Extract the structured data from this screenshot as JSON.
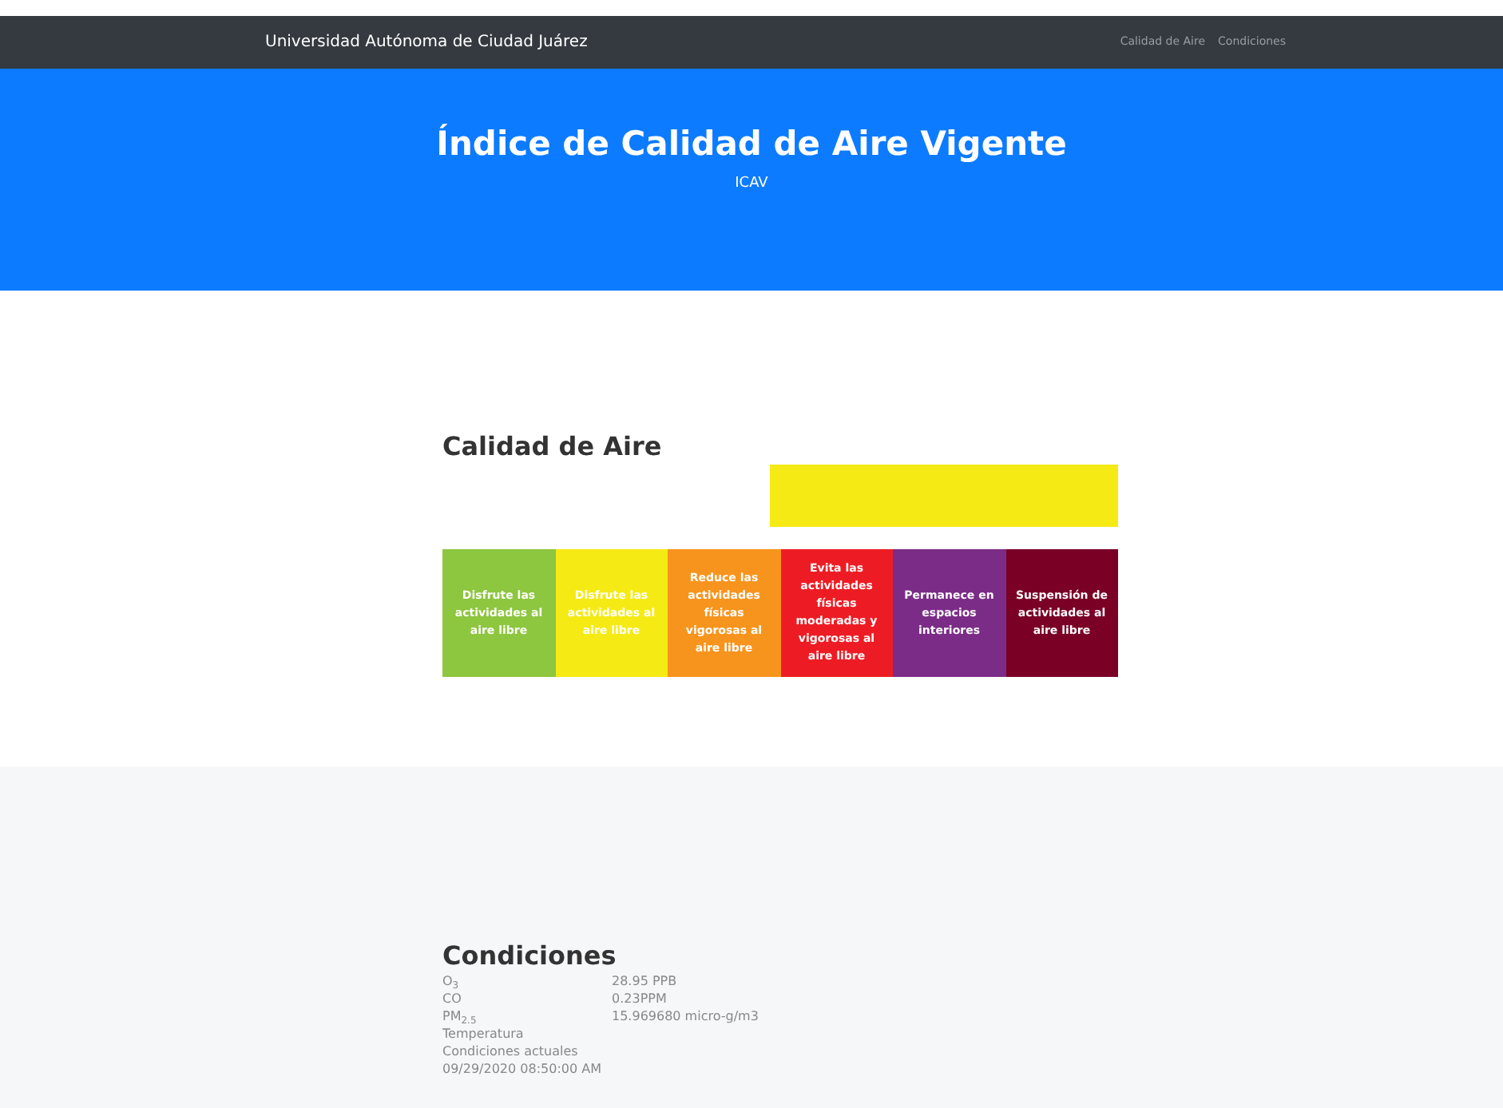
{
  "navbar": {
    "brand": "Universidad Autónoma de Ciudad Juárez",
    "links": [
      "Calidad de Aire",
      "Condiciones"
    ]
  },
  "hero": {
    "title": "Índice de Calidad de Aire Vigente",
    "subtitle": "ICAV"
  },
  "air_quality": {
    "title": "Calidad de Aire",
    "current": {
      "color": "#f5ea14"
    },
    "levels": [
      {
        "text": "Disfrute las actividades al aire libre",
        "color": "#8dc63f"
      },
      {
        "text": "Disfrute las actividades al aire libre",
        "color": "#f5ea14"
      },
      {
        "text": "Reduce las actividades físicas vigorosas al aire libre",
        "color": "#f7941d"
      },
      {
        "text": "Evita las actividades físicas moderadas y vigorosas al aire libre",
        "color": "#ed1c24"
      },
      {
        "text": "Permanece en espacios interiores",
        "color": "#7b2c87"
      },
      {
        "text": "Suspensión de actividades al aire libre",
        "color": "#7a0026"
      }
    ]
  },
  "conditions": {
    "title": "Condiciones",
    "rows": [
      {
        "label": "O$_{3}$",
        "value": "28.95 PPB"
      },
      {
        "label": "CO",
        "value": "0.23PPM"
      },
      {
        "label": "PM$_{2.5}$",
        "value": "15.969680 micro-g/m3"
      },
      {
        "label": "Temperatura"
      },
      {
        "label": "Condiciones actuales"
      },
      {
        "label": "09/29/2020 08:50:00 AM"
      }
    ]
  }
}
